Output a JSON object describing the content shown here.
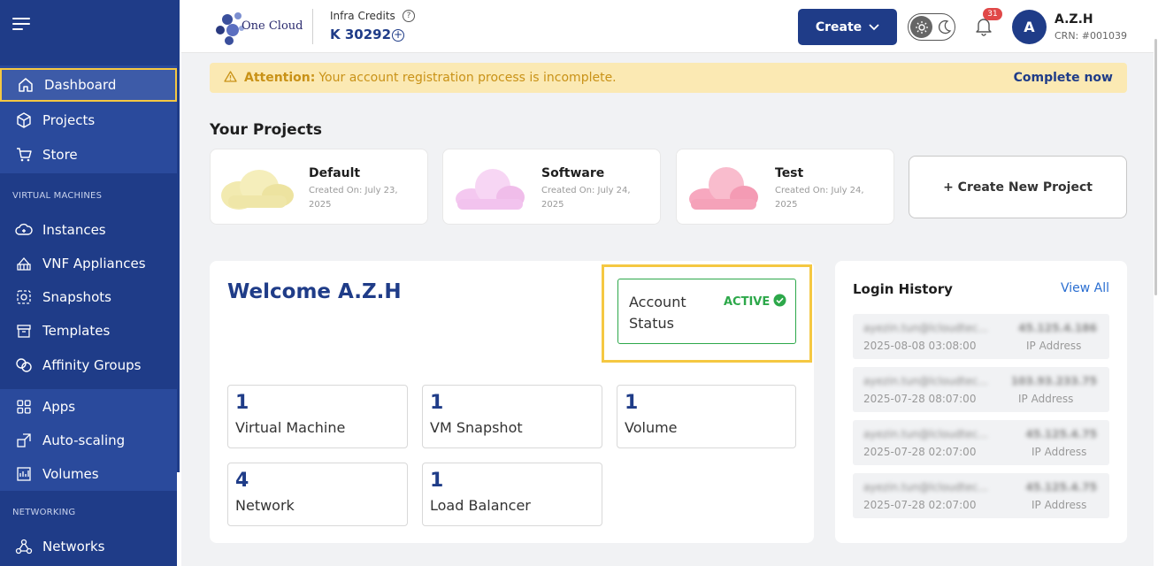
{
  "sidebar": {
    "items_top": [
      {
        "label": "Dashboard",
        "icon": "home-icon",
        "active": true
      },
      {
        "label": "Projects",
        "icon": "cube-icon"
      },
      {
        "label": "Store",
        "icon": "cart-icon"
      }
    ],
    "vm_heading": "VIRTUAL MACHINES",
    "items_vm": [
      {
        "label": "Instances",
        "icon": "cloud-plus-icon"
      },
      {
        "label": "VNF Appliances",
        "icon": "firewall-icon"
      },
      {
        "label": "Snapshots",
        "icon": "camera-icon"
      },
      {
        "label": "Templates",
        "icon": "template-icon"
      },
      {
        "label": "Affinity Groups",
        "icon": "affinity-icon"
      }
    ],
    "items_mid": [
      {
        "label": "Apps",
        "icon": "apps-grid-icon"
      },
      {
        "label": "Auto-scaling",
        "icon": "autoscale-icon"
      },
      {
        "label": "Volumes",
        "icon": "volume-icon"
      }
    ],
    "net_heading": "NETWORKING",
    "items_net": [
      {
        "label": "Networks",
        "icon": "network-icon"
      }
    ]
  },
  "header": {
    "logo_text": "One Cloud",
    "credits_label": "Infra Credits",
    "credits_value": "K 30292",
    "create_label": "Create",
    "notification_count": "31",
    "user_initial": "A",
    "user_name": "A.Z.H",
    "user_crn": "CRN: #001039"
  },
  "alert": {
    "label": "Attention:",
    "message": "Your account registration process is incomplete.",
    "action": "Complete now"
  },
  "projects": {
    "title": "Your Projects",
    "items": [
      {
        "name": "Default",
        "created": "Created On: July 23, 2025",
        "cloud_color": "#f2eab0"
      },
      {
        "name": "Software",
        "created": "Created On: July 24, 2025",
        "cloud_color": "#f4c8f0"
      },
      {
        "name": "Test",
        "created": "Created On: July 24, 2025",
        "cloud_color": "#f7a8bf"
      }
    ],
    "new_label": "+ Create New Project"
  },
  "welcome": {
    "title": "Welcome A.Z.H",
    "status_label": "Account Status",
    "status_value": "ACTIVE",
    "stats": [
      {
        "num": "1",
        "label": "Virtual Machine"
      },
      {
        "num": "1",
        "label": "VM Snapshot"
      },
      {
        "num": "1",
        "label": "Volume"
      },
      {
        "num": "4",
        "label": "Network"
      },
      {
        "num": "1",
        "label": "Load Balancer"
      }
    ]
  },
  "login_history": {
    "title": "Login History",
    "view_all": "View All",
    "ip_label": "IP Address",
    "entries": [
      {
        "email": "ayezin.tun@lcloudtec...",
        "ip": "45.125.4.186",
        "time": "2025-08-08 03:08:00"
      },
      {
        "email": "ayezin.tun@lcloudtec...",
        "ip": "103.93.233.75",
        "time": "2025-07-28 08:07:00"
      },
      {
        "email": "ayezin.tun@lcloudtec...",
        "ip": "45.125.4.75",
        "time": "2025-07-28 02:07:00"
      },
      {
        "email": "ayezin.tun@lcloudtec...",
        "ip": "45.125.4.75",
        "time": "2025-07-28 02:07:00"
      }
    ]
  },
  "colors": {
    "primary": "#1f3c88",
    "accent_highlight": "#f5c842",
    "active_green": "#2da84a",
    "alert_bg": "#fbe9b3",
    "badge_red": "#e04848"
  }
}
